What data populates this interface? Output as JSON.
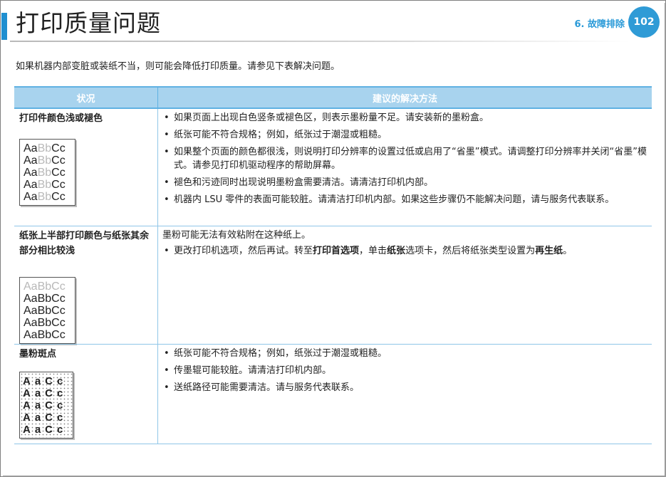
{
  "header": {
    "title": "打印质量问题",
    "chapter": "6. 故障排除",
    "page_number": "102"
  },
  "intro": "如果机器内部变脏或装纸不当，则可能会降低打印质量。请参见下表解决问题。",
  "table": {
    "col_condition": "状况",
    "col_solution": "建议的解决方法",
    "rows": [
      {
        "condition": "打印件颜色浅或褪色",
        "sample_lines": [
          [
            "Aa",
            "Bb",
            "Cc"
          ],
          [
            "Aa",
            "Bb",
            "Cc"
          ],
          [
            "Aa",
            "Bb",
            "Cc"
          ],
          [
            "Aa",
            "Bb",
            "Cc"
          ],
          [
            "Aa",
            "Bb",
            "Cc"
          ]
        ],
        "bullets": [
          "如果页面上出现白色竖条或褪色区，则表示墨粉量不足。请安装新的墨粉盒。",
          "纸张可能不符合规格；例如，纸张过于潮湿或粗糙。",
          "如果整个页面的颜色都很浅，则说明打印分辨率的设置过低或启用了“省墨”模式。请调整打印分辨率并关闭“省墨”模式。请参见打印机驱动程序的帮助屏幕。",
          "褪色和污迹同时出现说明墨粉盒需要清洁。请清洁打印机内部。",
          "机器内 LSU 零件的表面可能较脏。请清洁打印机内部。如果这些步骤仍不能解决问题，请与服务代表联系。"
        ]
      },
      {
        "condition": "纸张上半部打印颜色与纸张其余部分相比较浅",
        "sample_lines": [
          "AaBbCc",
          "AaBbCc",
          "AaBbCc",
          "AaBbCc",
          "AaBbCc"
        ],
        "intro": "墨粉可能无法有效粘附在这种纸上。",
        "bullet": {
          "p1": "更改打印机选项，然后再试。转至",
          "b1": "打印首选项",
          "p2": "，单击",
          "b2": "纸张",
          "p3": "选项卡，然后将纸张类型设置为",
          "b3": "再生纸",
          "p4": "。"
        }
      },
      {
        "condition": "墨粉斑点",
        "sample_lines": [
          "AaCc",
          "AaCc",
          "AaCc",
          "AaCc",
          "AaCc"
        ],
        "bullets": [
          "纸张可能不符合规格；例如，纸张过于潮湿或粗糙。",
          "传墨辊可能较脏。请清洁打印机内部。",
          "送纸路径可能需要清洁。请与服务代表联系。"
        ]
      }
    ]
  }
}
